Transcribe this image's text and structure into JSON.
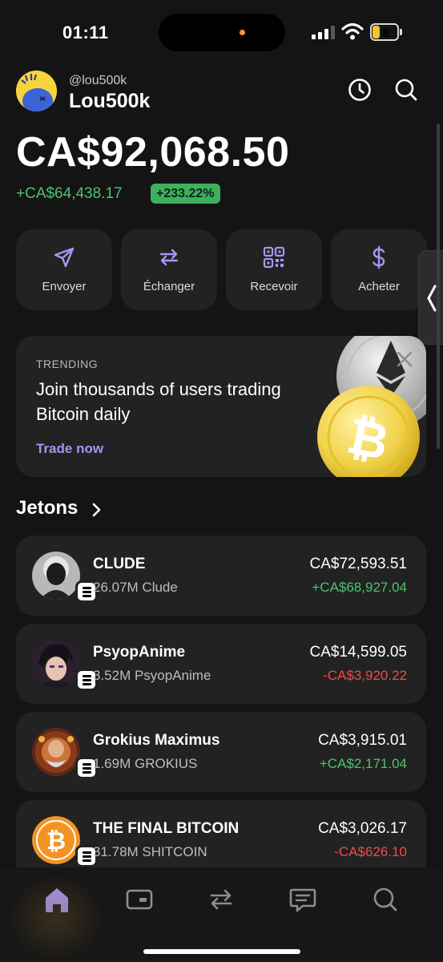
{
  "status_bar": {
    "time": "01:11",
    "battery": "8"
  },
  "header": {
    "handle": "@lou500k",
    "username": "Lou500k"
  },
  "portfolio": {
    "balance": "CA$92,068.50",
    "change": "+CA$64,438.17",
    "change_pct": "+233.22%"
  },
  "actions": [
    {
      "label": "Envoyer",
      "icon": "send-icon"
    },
    {
      "label": "Échanger",
      "icon": "swap-icon"
    },
    {
      "label": "Recevoir",
      "icon": "qr-code-icon"
    },
    {
      "label": "Acheter",
      "icon": "dollar-icon"
    }
  ],
  "trending": {
    "label": "TRENDING",
    "title": "Join thousands of users trading Bitcoin daily",
    "link": "Trade now"
  },
  "tokens_section": {
    "title": "Jetons"
  },
  "tokens": [
    {
      "name": "CLUDE",
      "amount": "26.07M Clude",
      "value": "CA$72,593.51",
      "change": "+CA$68,927.04",
      "direction": "up"
    },
    {
      "name": "PsyopAnime",
      "amount": "3.52M PsyopAnime",
      "value": "CA$14,599.05",
      "change": "-CA$3,920.22",
      "direction": "down"
    },
    {
      "name": "Grokius Maximus",
      "amount": "1.69M GROKIUS",
      "value": "CA$3,915.01",
      "change": "+CA$2,171.04",
      "direction": "up"
    },
    {
      "name": "THE FINAL BITCOIN",
      "amount": "31.78M SHITCOIN",
      "value": "CA$3,026.17",
      "change": "-CA$626.10",
      "direction": "down"
    }
  ],
  "bottom_nav": [
    "home-icon",
    "wallet-card-icon",
    "swap-icon",
    "chat-icon",
    "search-icon"
  ],
  "colors": {
    "accent": "#a596f3",
    "positive": "#4cc46e",
    "negative": "#ef4b4b",
    "card": "#222222",
    "background": "#141414"
  }
}
